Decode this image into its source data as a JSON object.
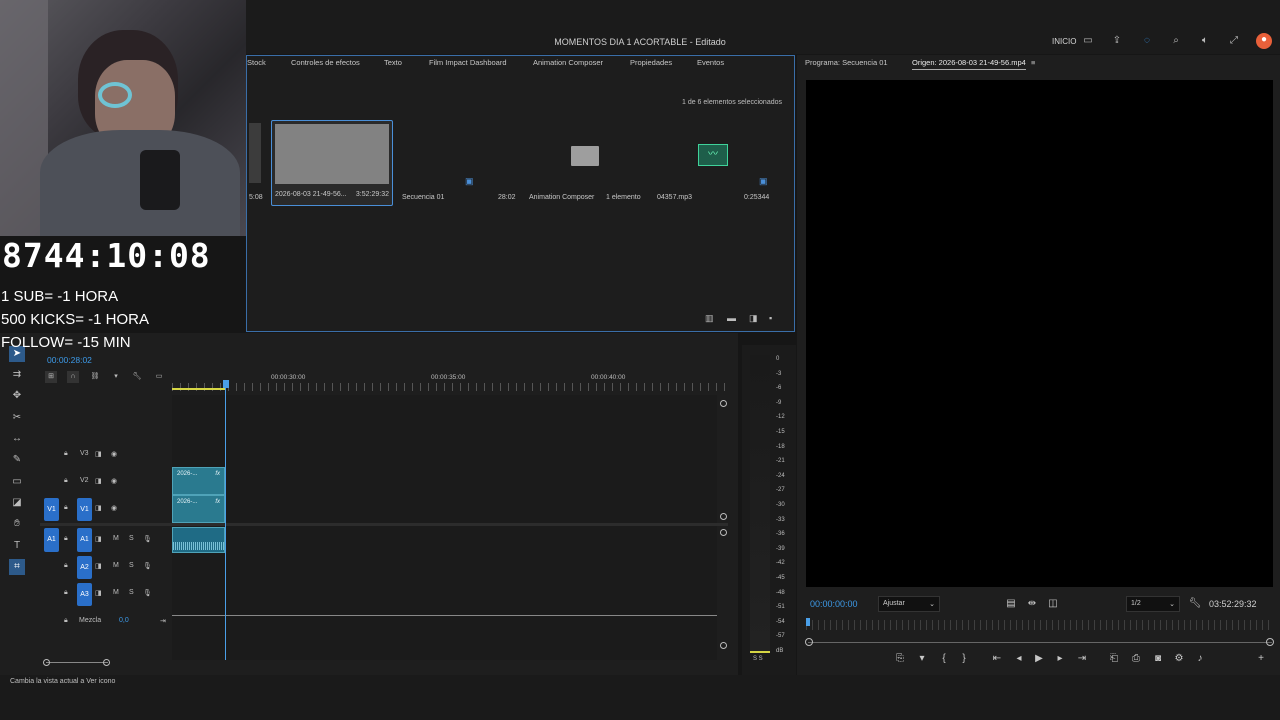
{
  "app": {
    "document_title": "MOMENTOS DIA 1 ACORTABLE - Editado",
    "workspace_label": "INICIO"
  },
  "project_panel": {
    "tabs": [
      "Stock",
      "Controles de efectos",
      "Texto",
      "Film Impact Dashboard",
      "Animation Composer",
      "Propiedades",
      "Eventos"
    ],
    "selection_count": "1 de 6 elementos seleccionados",
    "items": [
      {
        "label": "",
        "duration": "5:08"
      },
      {
        "label": "2026-08-03 21-49-56...",
        "duration": "3:52:29:32"
      },
      {
        "label": "Secuencia 01",
        "duration": "28:02"
      },
      {
        "label": "Animation Composer",
        "duration": "1 elemento"
      },
      {
        "label": "04357.mp3",
        "duration": "0:25344"
      }
    ]
  },
  "monitor": {
    "tabs": [
      "Programa: Secuencia 01",
      "Origen: 2026-08-03 21-49-56.mp4"
    ],
    "timecode_in": "00:00:00:00",
    "zoom_select": "Ajustar",
    "resolution_select": "1/2",
    "timecode_out": "03:52:29:32"
  },
  "timeline": {
    "current_time": "00:00:28:02",
    "ruler": [
      "00:00:30:00",
      "00:00:35:00",
      "00:00:40:00"
    ],
    "tracks": [
      {
        "name": "V3"
      },
      {
        "name": "V2"
      },
      {
        "name": "V1",
        "source": "V1"
      },
      {
        "name": "A1",
        "source": "A1"
      },
      {
        "name": "A2"
      },
      {
        "name": "A3"
      }
    ],
    "mix_label": "Mezcla",
    "mix_value": "0,0",
    "clip_label": "2026-..."
  },
  "audio_meter": {
    "scale": [
      "0",
      "-3",
      "-6",
      "-9",
      "-12",
      "-15",
      "-18",
      "-21",
      "-24",
      "-27",
      "-30",
      "-33",
      "-36",
      "-39",
      "-42",
      "-45",
      "-48",
      "-51",
      "-54",
      "-57",
      "dB"
    ],
    "bottom_labels": "S S"
  },
  "status_bar": {
    "text": "Cambia la vista actual a Ver icono"
  },
  "stream_overlay": {
    "timer": "8744:10:08",
    "lines": [
      "1 SUB= -1 HORA",
      "500 KICKS= -1 HORA",
      "FOLLOW= -15 MIN"
    ]
  },
  "colors": {
    "accent_blue": "#2a6fc9",
    "clip_teal": "#2a7a8f",
    "playhead": "#4a9fe8",
    "selection_border": "#3a6ea8"
  }
}
